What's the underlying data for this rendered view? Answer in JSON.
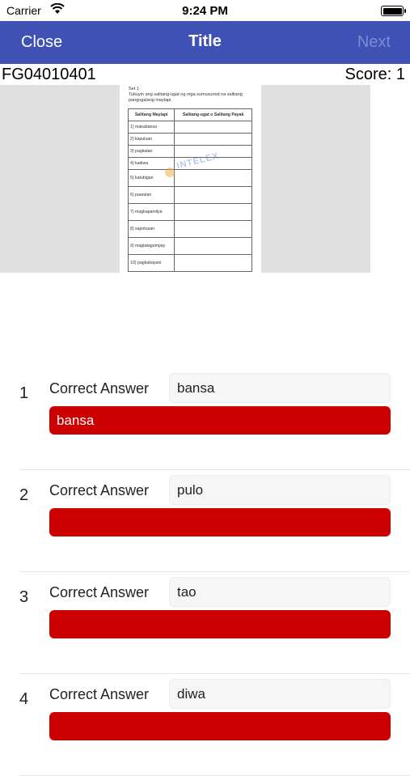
{
  "status_bar": {
    "carrier": "Carrier",
    "time": "9:24 PM"
  },
  "navbar": {
    "close": "Close",
    "title": "Title",
    "next": "Next",
    "accent": "#3f51b5"
  },
  "info": {
    "code": "FG04010401",
    "score": "Score: 1"
  },
  "worksheet": {
    "set": "Set 1",
    "instruction": "Tukuyin ang salitang-ugat ng mga sumusunod na salitang pangngalang maylapi.",
    "col1": "Salitang Maylapi",
    "col2": "Salitang-ugat o Salitang Payak",
    "rows": [
      "1) makabansa",
      "2) kapuluan",
      "3) pagkatao",
      "4) kadiwa",
      "5) katubigan",
      "6) paaralan",
      "7) magkapamilya",
      "8) sapotusan",
      "9) magtatagumpay",
      "10) pagkabayani"
    ],
    "watermark": "INTELEX"
  },
  "answers": [
    {
      "num": "1",
      "label": "Correct Answer",
      "correct": "bansa",
      "input": "bansa"
    },
    {
      "num": "2",
      "label": "Correct Answer",
      "correct": "pulo",
      "input": ""
    },
    {
      "num": "3",
      "label": "Correct Answer",
      "correct": "tao",
      "input": ""
    },
    {
      "num": "4",
      "label": "Correct Answer",
      "correct": "diwa",
      "input": ""
    }
  ],
  "colors": {
    "wrong_answer": "#cc0000"
  }
}
